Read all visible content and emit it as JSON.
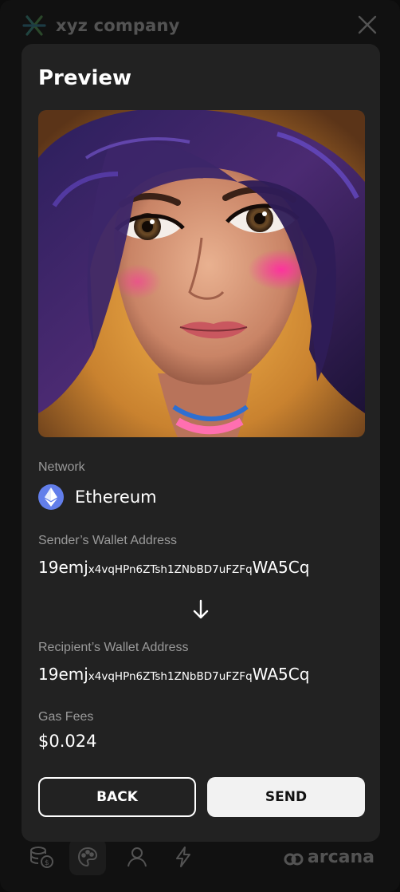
{
  "background": {
    "brand_name": "xyz company",
    "footer_brand": "arcana",
    "nav_icons": [
      "wallet-icon",
      "nft-gallery-icon",
      "profile-icon",
      "activity-icon"
    ]
  },
  "modal": {
    "title": "Preview",
    "network": {
      "label": "Network",
      "value": "Ethereum",
      "icon": "ethereum-icon",
      "icon_color": "#627eea"
    },
    "sender": {
      "label": "Sender’s Wallet Address",
      "address_start": "19emj",
      "address_middle": "x4vqHPn6ZTsh1ZNbBD7uFZFq",
      "address_end": "WA5Cq"
    },
    "recipient": {
      "label": "Recipient’s Wallet Address",
      "address_start": "19emj",
      "address_middle": "x4vqHPn6ZTsh1ZNbBD7uFZFq",
      "address_end": "WA5Cq"
    },
    "gas": {
      "label": "Gas Fees",
      "value": "$0.024"
    },
    "buttons": {
      "back": "BACK",
      "send": "SEND"
    }
  },
  "colors": {
    "modal_bg": "#222222",
    "page_bg": "#0c0c0c",
    "label": "#9a9a9a",
    "send_button_bg": "#f2f2f2"
  }
}
